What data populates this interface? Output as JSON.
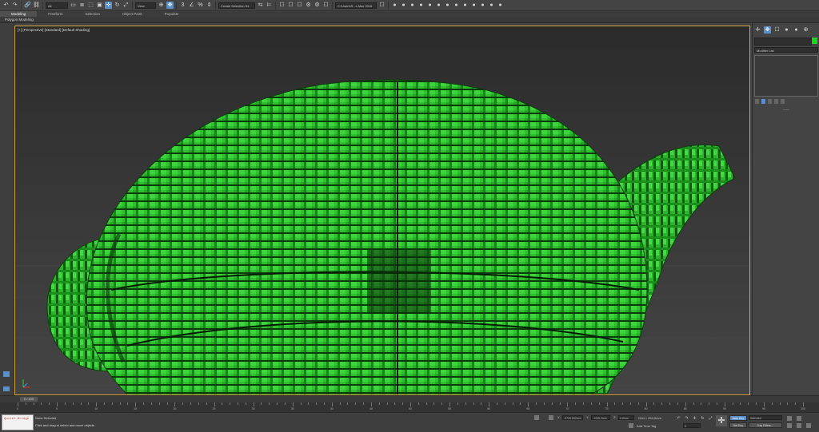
{
  "toolbar": {
    "undo": "↶",
    "redo": "↷",
    "link": "🔗",
    "unlink": "⛓",
    "filter_value": "All",
    "select_icon": "▭",
    "select_name_icon": "≣",
    "rect_region_icon": "⬚",
    "window_crossing_icon": "▣",
    "move_icon": "✛",
    "rotate_icon": "↻",
    "scale_icon": "⤢",
    "ref_coord_value": "View",
    "pivot_icon": "⊕",
    "manip_icon": "✥",
    "snap_icon": "3",
    "angle_snap_icon": "∠",
    "percent_snap_icon": "%",
    "spinner_snap_icon": "⇕",
    "selection_set_value": "Create Selection Se",
    "mirror_icon": "⇆",
    "align_icon": "⊨",
    "project_path": "C:\\Users\\S...s Max 2016",
    "render_icons": [
      "☐",
      "☐",
      "☐",
      "⚙",
      "⚙",
      "☐"
    ],
    "right_icons": [
      "●",
      "●",
      "●",
      "●",
      "●",
      "●",
      "●",
      "●",
      "●",
      "●",
      "●",
      "●",
      "●"
    ]
  },
  "ribbon": {
    "tabs": [
      "Modeling",
      "Freeform",
      "Selection",
      "Object Paint",
      "Populate"
    ],
    "active": "Modeling",
    "panel_label": "Polygon Modeling"
  },
  "viewport": {
    "label": "[+] [Perspective] [Standard] [Default Shading]",
    "object_color": "#2fbf2f"
  },
  "command_panel": {
    "modifier_list": "Modifier List",
    "swatch_color": "#1fd31f"
  },
  "time": {
    "slider_label": "0 / 100",
    "ticks": [
      "0",
      "5",
      "10",
      "15",
      "20",
      "25",
      "30",
      "35",
      "40",
      "45",
      "50",
      "55",
      "60",
      "65",
      "70",
      "75",
      "80",
      "85",
      "90",
      "95",
      "100"
    ]
  },
  "status": {
    "script_text": "Quixel Bridge",
    "selection": "None Selected",
    "prompt": "Click and drag to select and move objects",
    "x_label": "X:",
    "x_value": "-3725,002mm",
    "y_label": "Y:",
    "y_value": "-1235,2mm",
    "z_label": "Z:",
    "z_value": "0,0mm",
    "grid": "Grid = 254,0mm",
    "add_time_tag": "Add Time Tag",
    "frame_value": "0",
    "auto_key": "Auto Key",
    "set_key": "Set Key",
    "key_mode_value": "Selected",
    "key_filters": "Key Filters..."
  }
}
